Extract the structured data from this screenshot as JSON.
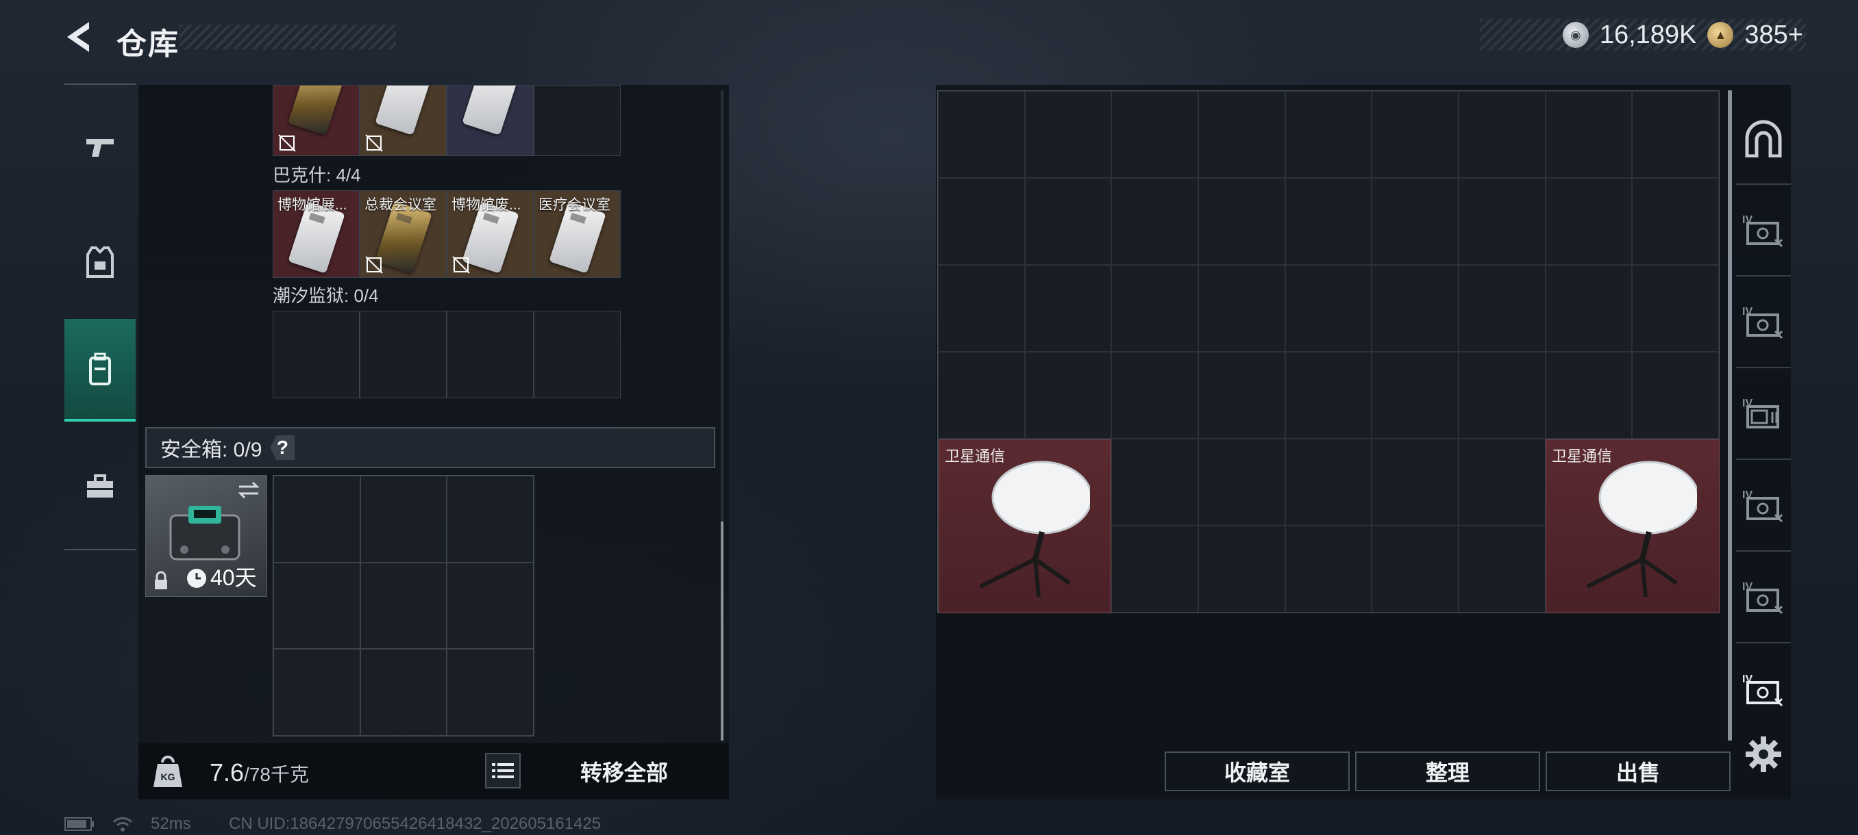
{
  "header": {
    "title": "仓库"
  },
  "currency": [
    {
      "icon": "silver-coin-icon",
      "value": "16,189K"
    },
    {
      "icon": "gold-coin-icon",
      "value": "385+"
    }
  ],
  "left_nav": [
    {
      "icon": "gun-icon"
    },
    {
      "icon": "armor-vest-icon"
    },
    {
      "icon": "backpack-icon",
      "active": true
    },
    {
      "icon": "toolbox-icon"
    }
  ],
  "keycards": {
    "top_row": [
      {
        "label": "",
        "gold": true,
        "banned": true
      },
      {
        "label": "",
        "gold": false,
        "banned": true
      },
      {
        "label": "",
        "gold": false,
        "banned": false
      },
      {
        "label": "",
        "empty": true
      }
    ],
    "bakshi_label": "巴克什: 4/4",
    "bakshi_row": [
      {
        "label": "博物馆展...",
        "gold": false,
        "banned": false
      },
      {
        "label": "总裁会议室",
        "gold": true,
        "banned": true
      },
      {
        "label": "博物馆废...",
        "gold": false,
        "banned": true
      },
      {
        "label": "医疗会议室",
        "gold": false,
        "banned": false
      }
    ],
    "prison_label": "潮汐监狱: 0/4"
  },
  "safebox": {
    "label": "安全箱: 0/9",
    "help": "?",
    "days": "40天"
  },
  "bottom": {
    "weight_value": "7.6",
    "weight_max": "/78千克",
    "transfer_all": "转移全部"
  },
  "status": {
    "ping": "52ms",
    "uid": "CN UID:18642797065542641843​2_202605161425"
  },
  "stash": {
    "rows": 6,
    "cols": 9,
    "items": [
      {
        "label": "卫星通信",
        "col": 0,
        "row": 4
      },
      {
        "label": "卫星通信",
        "col": 7,
        "row": 4
      }
    ]
  },
  "actions": {
    "collection": "收藏室",
    "sort": "整理",
    "sell": "出售"
  },
  "right_tabs": [
    "arch-icon",
    "safe-iv-icon",
    "safe-iv-icon",
    "safe-iv-icon",
    "safe-iv-icon",
    "safe-iv-icon",
    "safe-iv-icon"
  ]
}
